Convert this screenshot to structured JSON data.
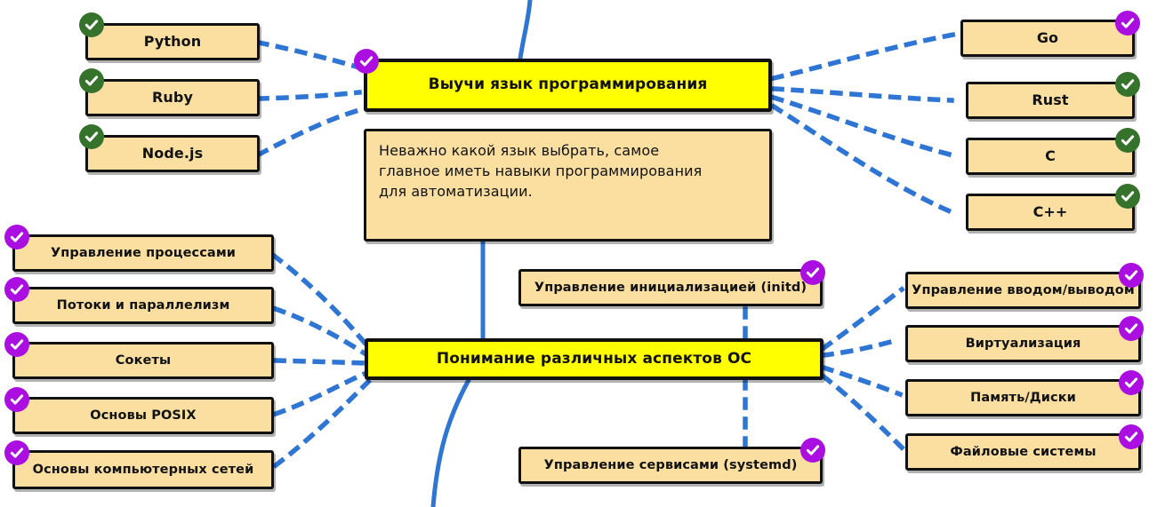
{
  "diagram": {
    "title": "Roadmap: Learn a programming language / Understand OS aspects",
    "colors": {
      "topic_fill": "#ffff00",
      "leaf_fill": "#fadfa1",
      "outline": "#111111",
      "edge_blue": "#2e75d4",
      "badge_done": "#35722b",
      "badge_recommended": "#aa0ee0",
      "background": "#ffffff"
    },
    "topics": [
      {
        "id": "topic-learn-language",
        "label": "Выучи язык программирования",
        "badge": "purple"
      },
      {
        "id": "topic-os-aspects",
        "label": "Понимание различных аспектов ОС",
        "badge": "purple"
      }
    ],
    "note": {
      "id": "note-language-choice",
      "text": "Неважно какой язык выбрать, самое\nглавное иметь навыки программирования\nдля автоматизации."
    },
    "languages_left": [
      {
        "label": "Python",
        "badge": "green"
      },
      {
        "label": "Ruby",
        "badge": "green"
      },
      {
        "label": "Node.js",
        "badge": "green"
      }
    ],
    "languages_right": [
      {
        "label": "Go",
        "badge": "purple"
      },
      {
        "label": "Rust",
        "badge": "green"
      },
      {
        "label": "C",
        "badge": "green"
      },
      {
        "label": "C++",
        "badge": "green"
      }
    ],
    "os_left": [
      {
        "label": "Управление процессами",
        "badge": "purple"
      },
      {
        "label": "Потоки и параллелизм",
        "badge": "purple"
      },
      {
        "label": "Сокеты",
        "badge": "purple"
      },
      {
        "label": "Основы POSIX",
        "badge": "purple"
      },
      {
        "label": "Основы компьютерных сетей",
        "badge": "purple"
      }
    ],
    "os_right": [
      {
        "label": "Управление вводом/выводом",
        "badge": "purple"
      },
      {
        "label": "Виртуализация",
        "badge": "purple"
      },
      {
        "label": "Память/Диски",
        "badge": "purple"
      },
      {
        "label": "Файловые системы",
        "badge": "purple"
      }
    ],
    "os_center": [
      {
        "label": "Управление инициализацией (initd)",
        "badge": "purple"
      },
      {
        "label": "Управление сервисами (systemd)",
        "badge": "purple"
      }
    ],
    "legend": {
      "done_icon": "check-circle-green",
      "recommended_icon": "check-circle-purple"
    }
  }
}
